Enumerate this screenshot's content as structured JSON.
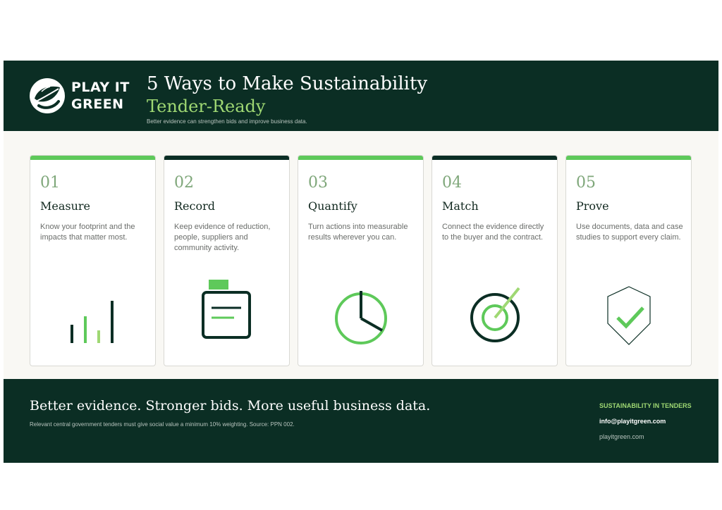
{
  "brand": {
    "line1": "PLAY IT",
    "line2": "GREEN"
  },
  "header": {
    "title": "5 Ways to Make Sustainability",
    "title_accent": "Tender-Ready",
    "subtitle": "Better evidence can strengthen bids and improve business data."
  },
  "cards": [
    {
      "number": "01",
      "title": "Measure",
      "text": "Know your footprint and the impacts that matter most.",
      "icon": "bar-chart-icon"
    },
    {
      "number": "02",
      "title": "Record",
      "text": "Keep evidence of reduction, people, suppliers and community activity.",
      "icon": "clipboard-icon"
    },
    {
      "number": "03",
      "title": "Quantify",
      "text": "Turn actions into measurable results wherever you can.",
      "icon": "pie-clock-icon"
    },
    {
      "number": "04",
      "title": "Match",
      "text": "Connect the evidence directly to the buyer and the contract.",
      "icon": "target-icon"
    },
    {
      "number": "05",
      "title": "Prove",
      "text": "Use documents, data and case studies to support every claim.",
      "icon": "shield-check-icon"
    }
  ],
  "footer": {
    "tagline": "Better evidence. Stronger bids. More useful business data.",
    "note": "Relevant central government tenders must give social value a minimum 10% weighting. Source: PPN 002.",
    "label": "SUSTAINABILITY IN TENDERS",
    "email": "info@playitgreen.com",
    "website": "playitgreen.com"
  },
  "colors": {
    "dark_green": "#0b2e24",
    "accent_green": "#5ec95a",
    "light_green": "#9fd873",
    "cream": "#f9f8f4"
  }
}
